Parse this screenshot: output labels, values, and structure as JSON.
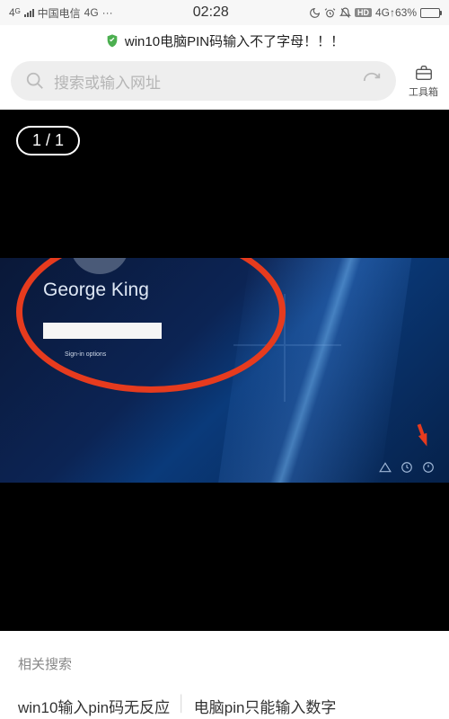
{
  "status": {
    "carrier": "中国电信",
    "network": "4G",
    "more": "···",
    "time": "02:28",
    "network_right": "4G",
    "battery_pct": "63%",
    "hd": "HD",
    "fourg_label": "4ᴳ"
  },
  "header": {
    "title": "win10电脑PIN码输入不了字母！！！"
  },
  "search": {
    "placeholder": "搜索或输入网址",
    "toolbox_label": "工具箱"
  },
  "viewer": {
    "page_indicator": "1 / 1",
    "lockscreen": {
      "username": "George King",
      "signin_options": "Sign-in options"
    }
  },
  "related": {
    "heading": "相关搜索",
    "links": [
      "win10输入pin码无反应",
      "电脑pin只能输入数字"
    ]
  }
}
